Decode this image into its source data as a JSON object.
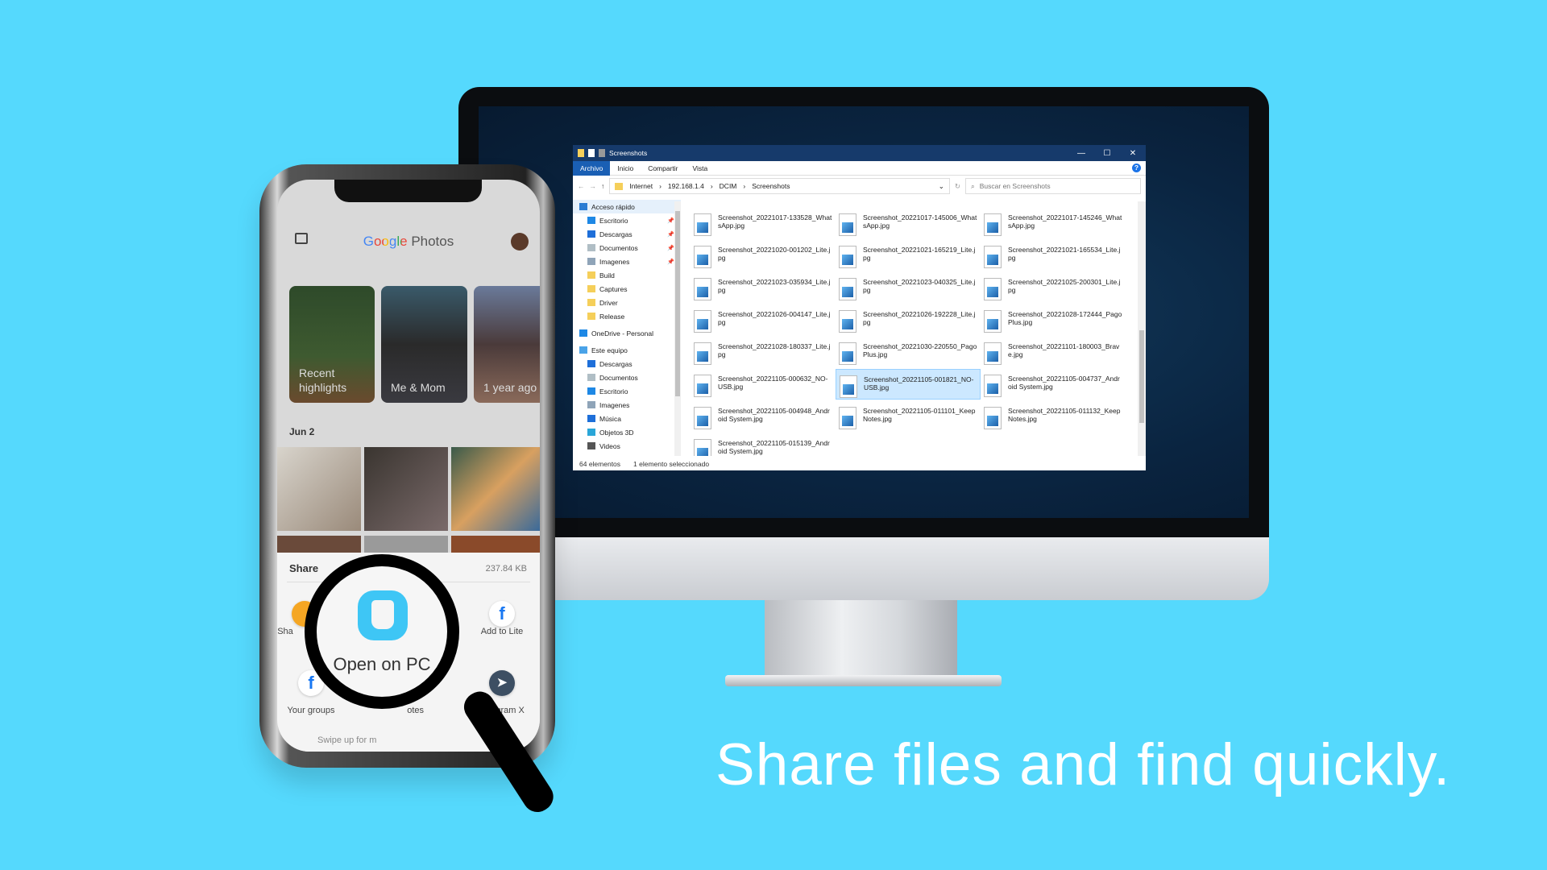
{
  "headline": "Share files and find quickly.",
  "colors": {
    "background": "#55d9fd",
    "explorer_title_bar": "#163a6b",
    "selection": "#cce8ff",
    "open_on_pc_icon": "#3ec6f5"
  },
  "explorer": {
    "title": "Screenshots",
    "window_controls": [
      "—",
      "☐",
      "✕"
    ],
    "ribbon_tabs": [
      "Archivo",
      "Inicio",
      "Compartir",
      "Vista"
    ],
    "help": "?",
    "breadcrumb": [
      "Internet",
      "192.168.1.4",
      "DCIM",
      "Screenshots"
    ],
    "search_placeholder": "Buscar en Screenshots",
    "nav_items": [
      {
        "label": "Acceso rápido",
        "top": true,
        "icon": "star-icon",
        "color": "#2b7cd3",
        "selected": true
      },
      {
        "label": "Escritorio",
        "icon": "desktop-icon",
        "color": "#1e88e5",
        "pinned": true
      },
      {
        "label": "Descargas",
        "icon": "download-icon",
        "color": "#1e6fd9",
        "pinned": true
      },
      {
        "label": "Documentos",
        "icon": "document-icon",
        "color": "#b0bec5",
        "pinned": true
      },
      {
        "label": "Imagenes",
        "icon": "images-icon",
        "color": "#8fa4b8",
        "pinned": true
      },
      {
        "label": "Build",
        "icon": "folder-icon",
        "color": "#f5cf5a"
      },
      {
        "label": "Captures",
        "icon": "folder-icon",
        "color": "#f5cf5a"
      },
      {
        "label": "Driver",
        "icon": "folder-icon",
        "color": "#f5cf5a"
      },
      {
        "label": "Release",
        "icon": "folder-icon",
        "color": "#f5cf5a"
      },
      {
        "label": "OneDrive - Personal",
        "top": true,
        "icon": "cloud-icon",
        "color": "#1e88e5"
      },
      {
        "label": "Este equipo",
        "top": true,
        "icon": "computer-icon",
        "color": "#4aa3e8"
      },
      {
        "label": "Descargas",
        "icon": "download-icon",
        "color": "#1e6fd9"
      },
      {
        "label": "Documentos",
        "icon": "document-icon",
        "color": "#b0bec5"
      },
      {
        "label": "Escritorio",
        "icon": "desktop-icon",
        "color": "#1e88e5"
      },
      {
        "label": "Imagenes",
        "icon": "images-icon",
        "color": "#8fa4b8"
      },
      {
        "label": "Música",
        "icon": "music-icon",
        "color": "#1e6fd9"
      },
      {
        "label": "Objetos 3D",
        "icon": "cube-icon",
        "color": "#2aa6d8"
      },
      {
        "label": "Videos",
        "icon": "video-icon",
        "color": "#555"
      }
    ],
    "files": [
      {
        "name": "Screenshot_20221017-133528_WhatsApp.jpg"
      },
      {
        "name": "Screenshot_20221017-145006_WhatsApp.jpg"
      },
      {
        "name": "Screenshot_20221017-145246_WhatsApp.jpg"
      },
      {
        "name": "Screenshot_20221020-001202_Lite.jpg"
      },
      {
        "name": "Screenshot_20221021-165219_Lite.jpg"
      },
      {
        "name": "Screenshot_20221021-165534_Lite.jpg"
      },
      {
        "name": "Screenshot_20221023-035934_Lite.jpg"
      },
      {
        "name": "Screenshot_20221023-040325_Lite.jpg"
      },
      {
        "name": "Screenshot_20221025-200301_Lite.jpg"
      },
      {
        "name": "Screenshot_20221026-004147_Lite.jpg"
      },
      {
        "name": "Screenshot_20221026-192228_Lite.jpg"
      },
      {
        "name": "Screenshot_20221028-172444_PagoPlus.jpg"
      },
      {
        "name": "Screenshot_20221028-180337_Lite.jpg"
      },
      {
        "name": "Screenshot_20221030-220550_PagoPlus.jpg"
      },
      {
        "name": "Screenshot_20221101-180003_Brave.jpg"
      },
      {
        "name": "Screenshot_20221105-000632_NO-USB.jpg"
      },
      {
        "name": "Screenshot_20221105-001821_NO-USB.jpg",
        "selected": true
      },
      {
        "name": "Screenshot_20221105-004737_Android System.jpg"
      },
      {
        "name": "Screenshot_20221105-004948_Android System.jpg"
      },
      {
        "name": "Screenshot_20221105-011101_KeepNotes.jpg"
      },
      {
        "name": "Screenshot_20221105-011132_KeepNotes.jpg"
      },
      {
        "name": "Screenshot_20221105-015139_Android System.jpg"
      }
    ],
    "status_count": "64 elementos",
    "status_selected": "1 elemento seleccionado"
  },
  "phone": {
    "app_title_google": "Google",
    "app_title_photos": "Photos",
    "highlights": [
      "Recent highlights",
      "Me & Mom",
      "1 year ago"
    ],
    "date_header": "Jun 2",
    "share_title": "Share",
    "share_size": "237.84 KB",
    "share_targets": [
      {
        "label": "Sha",
        "icon": "app-icon",
        "color": "#f5a623"
      },
      {
        "label": "Add to Lite",
        "icon": "facebook-icon",
        "glyph": "f"
      },
      {
        "label": "Your groups",
        "icon": "facebook-icon",
        "glyph": "f"
      },
      {
        "label": "otes",
        "icon": "notes-icon",
        "color": "#f6c026"
      },
      {
        "label": "Telegram X",
        "icon": "telegram-icon",
        "glyph": "➤"
      }
    ],
    "swipe_hint": "Swipe up for m"
  },
  "magnifier": {
    "label": "Open on PC"
  }
}
